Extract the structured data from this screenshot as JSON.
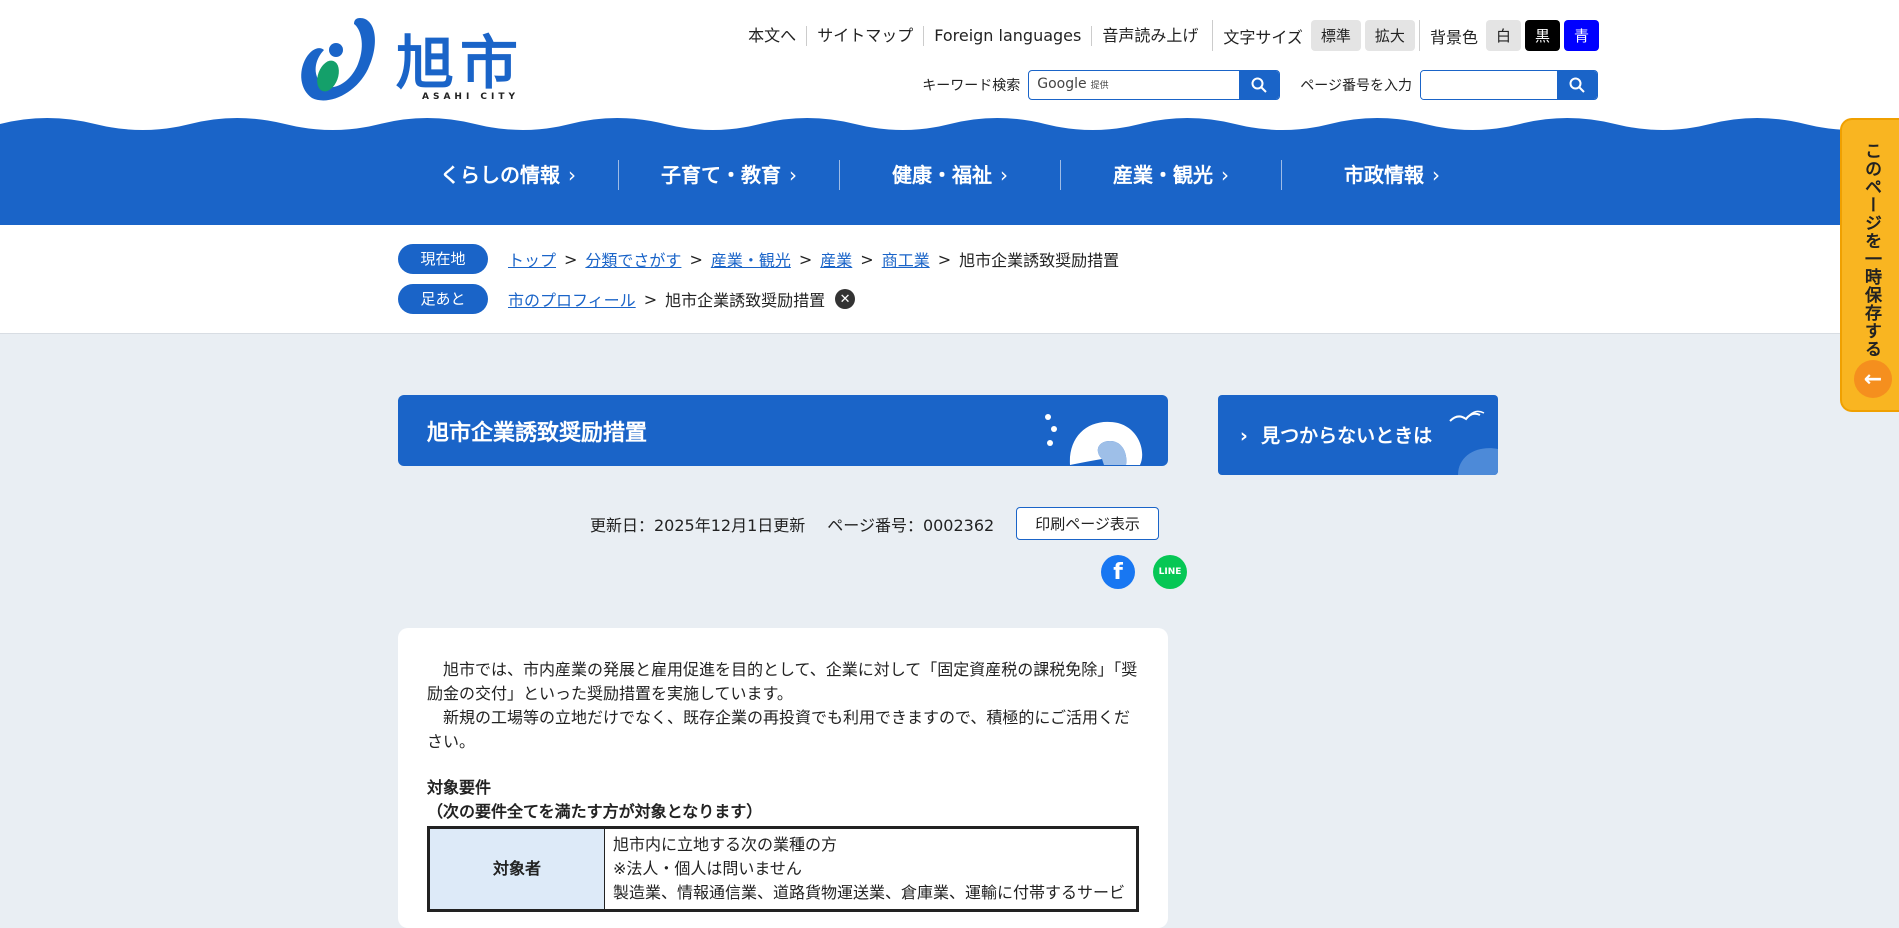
{
  "logo": {
    "text": "旭市",
    "sub": "ASAHI CITY"
  },
  "util": {
    "links": [
      "本文へ",
      "サイトマップ",
      "Foreign languages",
      "音声読み上げ"
    ],
    "font_size_label": "文字サイズ",
    "font_size_options": [
      "標準",
      "拡大"
    ],
    "bg_label": "背景色",
    "bg_options": [
      "白",
      "黒",
      "青"
    ]
  },
  "search": {
    "keyword_label": "キーワード検索",
    "google_label": "Google",
    "google_sub": "提供",
    "page_number_label": "ページ番号を入力"
  },
  "nav": {
    "items": [
      "くらしの情報",
      "子育て・教育",
      "健康・福祉",
      "産業・観光",
      "市政情報"
    ]
  },
  "breadcrumb": {
    "current_label": "現在地",
    "current": [
      "トップ",
      "分類でさがす",
      "産業・観光",
      "産業",
      "商工業"
    ],
    "current_page": "旭市企業誘致奨励措置",
    "history_label": "足あと",
    "history": [
      "市のプロフィール"
    ],
    "history_page": "旭市企業誘致奨励措置"
  },
  "page": {
    "title": "旭市企業誘致奨励措置",
    "updated": "更新日：2025年12月1日更新",
    "page_number": "ページ番号：0002362",
    "print_label": "印刷ページ表示"
  },
  "content": {
    "para1": "　旭市では、市内産業の発展と雇用促進を目的として、企業に対して「固定資産税の課税免除」「奨励金の交付」といった奨励措置を実施しています。",
    "para2": "　新規の工場等の立地だけでなく、既存企業の再投資でも利用できますので、積極的にご活用ください。",
    "heading1": "対象要件",
    "heading2": "（次の要件全てを満たす方が対象となります）",
    "table": {
      "row1_header": "対象者",
      "row1_line1": "旭市内に立地する次の業種の方",
      "row1_line2": "※法人・個人は問いません",
      "row1_line3": "製造業、情報通信業、道路貨物運送業、倉庫業、運輸に付帯するサービ"
    }
  },
  "side": {
    "not_found": "見つからないときは"
  },
  "save": {
    "label": "このページを一時保存する"
  },
  "colors": {
    "primary": "#1a64c8",
    "save": "#f9b521",
    "bg": "#e9eef3"
  }
}
